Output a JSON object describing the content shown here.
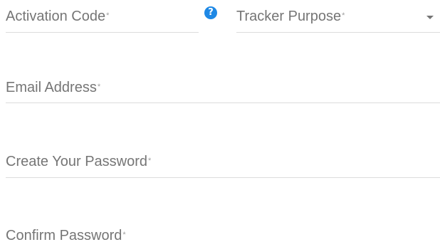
{
  "form": {
    "activation_code": {
      "label": "Activation Code",
      "required_mark": "*"
    },
    "help_icon": "?",
    "tracker_purpose": {
      "label": "Tracker Purpose",
      "required_mark": "*"
    },
    "email": {
      "label": "Email Address",
      "required_mark": "*"
    },
    "create_password": {
      "label": "Create Your Password",
      "required_mark": "*"
    },
    "confirm_password": {
      "label": "Confirm Password",
      "required_mark": "*"
    }
  },
  "colors": {
    "label": "#757575",
    "underline": "#dcdcdc",
    "help_icon": "#1e88e5"
  },
  "icons": {
    "help": "question-circle-icon",
    "dropdown": "caret-down-icon"
  }
}
